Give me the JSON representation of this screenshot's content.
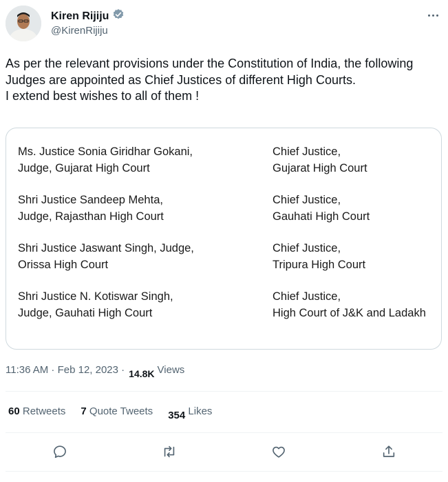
{
  "author": {
    "name": "Kiren Rijiju",
    "handle": "@KirenRijiju",
    "verified": true,
    "verified_color": "#829aab"
  },
  "tweet": {
    "line1": "As per the relevant provisions under the Constitution of India, the following Judges are appointed as Chief Justices of different High Courts.",
    "line2": "I extend best wishes to all of them !"
  },
  "appointments": [
    {
      "judge_l1": "Ms. Justice Sonia Giridhar Gokani,",
      "judge_l2": "Judge, Gujarat High Court",
      "post_l1": "Chief Justice,",
      "post_l2": "Gujarat High Court"
    },
    {
      "judge_l1": "Shri Justice Sandeep Mehta,",
      "judge_l2": "Judge, Rajasthan High Court",
      "post_l1": "Chief Justice,",
      "post_l2": "Gauhati High Court"
    },
    {
      "judge_l1": "Shri Justice Jaswant Singh, Judge,",
      "judge_l2": "Orissa High Court",
      "post_l1": "Chief Justice,",
      "post_l2": "Tripura High Court"
    },
    {
      "judge_l1": "Shri Justice N. Kotiswar Singh,",
      "judge_l2": "Judge, Gauhati High Court",
      "post_l1": "Chief Justice,",
      "post_l2": "High Court of J&K and Ladakh"
    }
  ],
  "meta": {
    "timestamp": "11:36 AM · Feb 12, 2023 ·",
    "views_count": "14.8K",
    "views_label": "Views"
  },
  "stats": {
    "retweets_count": "60",
    "retweets_label": "Retweets",
    "quote_count": "7",
    "quote_label": "Quote Tweets",
    "likes_count": "354",
    "likes_label": "Likes"
  },
  "icons": {
    "reply": "reply-icon",
    "retweet": "retweet-icon",
    "like": "like-icon",
    "share": "share-icon",
    "more": "more-icon",
    "verified": "verified-badge-icon"
  }
}
